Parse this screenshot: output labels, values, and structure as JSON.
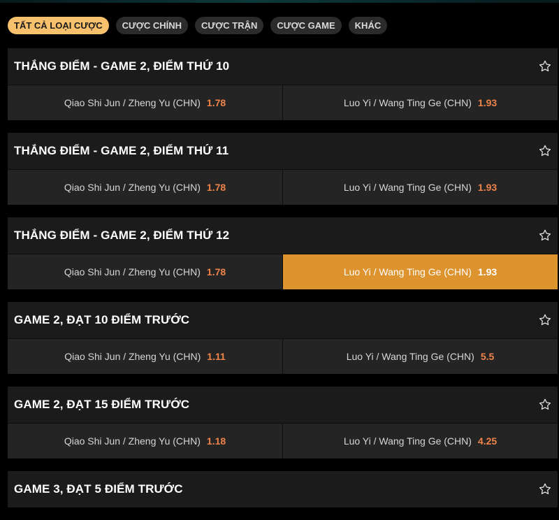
{
  "filters": [
    {
      "label": "TẤT CẢ LOẠI CƯỢC",
      "active": true
    },
    {
      "label": "CƯỢC CHÍNH",
      "active": false
    },
    {
      "label": "CƯỢC TRẬN",
      "active": false
    },
    {
      "label": "CƯỢC GAME",
      "active": false
    },
    {
      "label": "KHÁC",
      "active": false
    }
  ],
  "markets": [
    {
      "title": "THẮNG ĐIỂM - GAME 2, ĐIỂM THỨ 10",
      "outcomes": [
        {
          "name": "Qiao Shi Jun / Zheng Yu (CHN)",
          "odds": "1.78",
          "selected": false
        },
        {
          "name": "Luo Yi / Wang Ting Ge (CHN)",
          "odds": "1.93",
          "selected": false
        }
      ]
    },
    {
      "title": "THẮNG ĐIỂM - GAME 2, ĐIỂM THỨ 11",
      "outcomes": [
        {
          "name": "Qiao Shi Jun / Zheng Yu (CHN)",
          "odds": "1.78",
          "selected": false
        },
        {
          "name": "Luo Yi / Wang Ting Ge (CHN)",
          "odds": "1.93",
          "selected": false
        }
      ]
    },
    {
      "title": "THẮNG ĐIỂM - GAME 2, ĐIỂM THỨ 12",
      "outcomes": [
        {
          "name": "Qiao Shi Jun / Zheng Yu (CHN)",
          "odds": "1.78",
          "selected": false
        },
        {
          "name": "Luo Yi / Wang Ting Ge (CHN)",
          "odds": "1.93",
          "selected": true
        }
      ]
    },
    {
      "title": "GAME 2, ĐẠT 10 ĐIỂM TRƯỚC",
      "outcomes": [
        {
          "name": "Qiao Shi Jun / Zheng Yu (CHN)",
          "odds": "1.11",
          "selected": false
        },
        {
          "name": "Luo Yi / Wang Ting Ge (CHN)",
          "odds": "5.5",
          "selected": false
        }
      ]
    },
    {
      "title": "GAME 2, ĐẠT 15 ĐIỂM TRƯỚC",
      "outcomes": [
        {
          "name": "Qiao Shi Jun / Zheng Yu (CHN)",
          "odds": "1.18",
          "selected": false
        },
        {
          "name": "Luo Yi / Wang Ting Ge (CHN)",
          "odds": "4.25",
          "selected": false
        }
      ]
    },
    {
      "title": "GAME 3, ĐẠT 5 ĐIỂM TRƯỚC",
      "outcomes": []
    }
  ],
  "icons": {
    "favorite": "star-outline-icon"
  },
  "colors": {
    "active_chip": "#f6c06c",
    "odds": "#f0834a",
    "selected_outcome": "#dd932e"
  }
}
